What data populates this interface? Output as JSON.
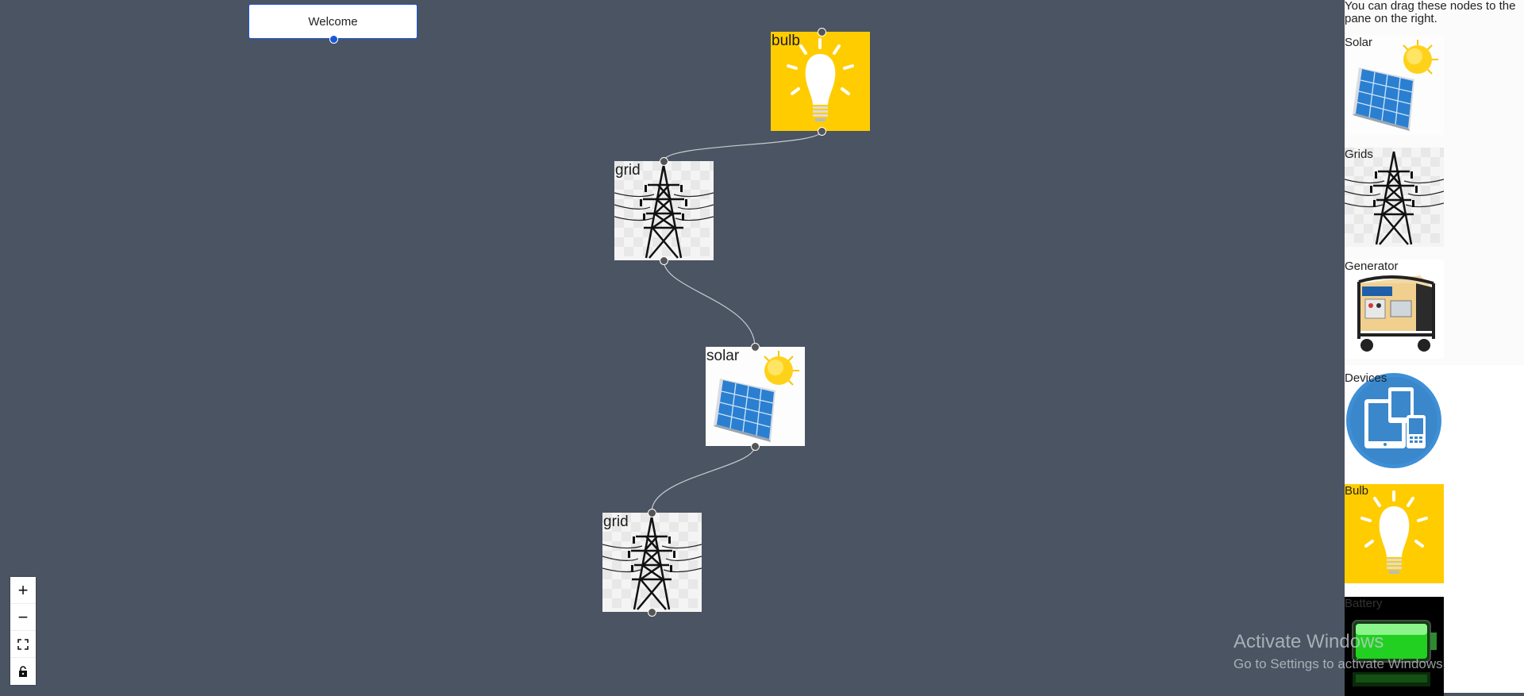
{
  "canvas": {
    "welcome_label": "Welcome",
    "nodes": [
      {
        "label": "bulb",
        "icon": "bulb-icon"
      },
      {
        "label": "grid",
        "icon": "grid-tower-icon"
      },
      {
        "label": "solar",
        "icon": "solar-panel-icon"
      },
      {
        "label": "grid",
        "icon": "grid-tower-icon"
      }
    ],
    "colors": {
      "background": "#4a5462",
      "bulb_bg": "#ffcc00",
      "edge": "#c9ccd1"
    }
  },
  "controls": {
    "zoom_in": "+",
    "zoom_out": "−",
    "fit_view": "⛶",
    "lock": "🔓"
  },
  "sidebar": {
    "description": "You can drag these nodes to the pane on the right.",
    "items": [
      {
        "label": "Solar",
        "icon": "solar-panel-icon"
      },
      {
        "label": "Grids",
        "icon": "grid-tower-icon"
      },
      {
        "label": "Generator",
        "icon": "generator-icon"
      },
      {
        "label": "Devices",
        "icon": "devices-icon"
      },
      {
        "label": "Bulb",
        "icon": "bulb-icon"
      },
      {
        "label": "Battery",
        "icon": "battery-icon"
      }
    ]
  },
  "watermark": {
    "title": "Activate Windows",
    "subtitle": "Go to Settings to activate Windows."
  }
}
